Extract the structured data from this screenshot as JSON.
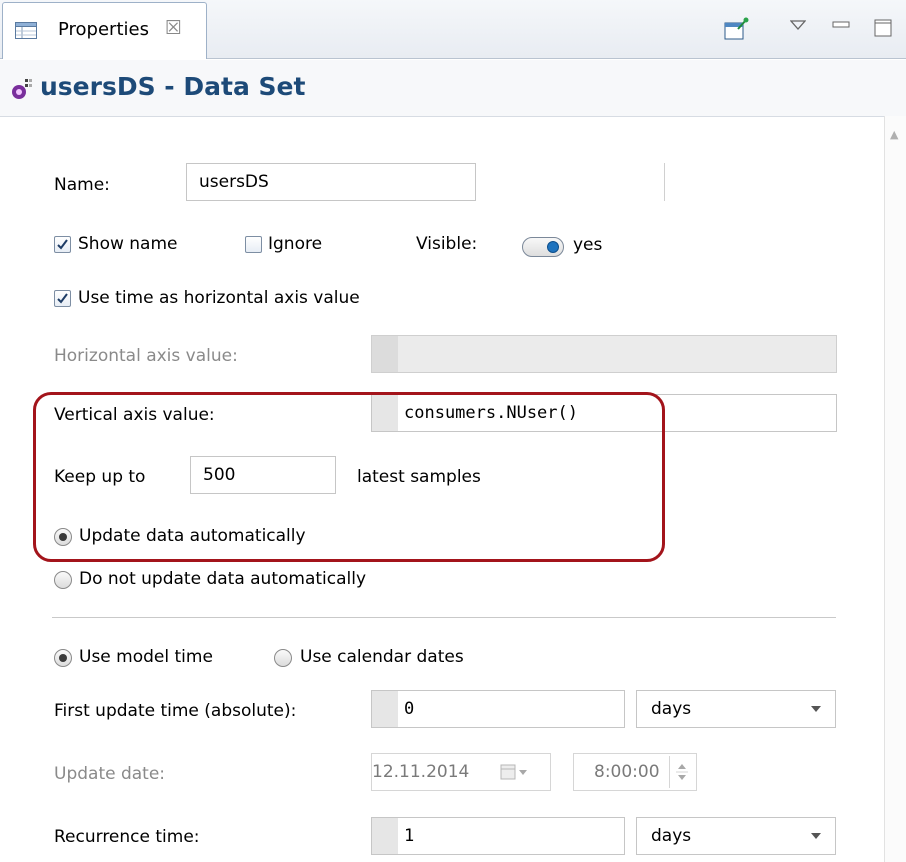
{
  "tab": {
    "label": "Properties",
    "close": "☒"
  },
  "header": {
    "title": "usersDS - Data Set"
  },
  "form": {
    "name_label": "Name:",
    "name_value": "usersDS",
    "show_name_label": "Show name",
    "ignore_label": "Ignore",
    "visible_label": "Visible:",
    "visible_value": "yes",
    "use_time_label": "Use time as horizontal axis value",
    "horizontal_label": "Horizontal axis value:",
    "vertical_label": "Vertical axis value:",
    "vertical_value": "consumers.NUser()",
    "keep_prefix": "Keep up to",
    "keep_value": "500",
    "keep_suffix": "latest samples",
    "update_auto_label": "Update data automatically",
    "no_update_label": "Do not update data automatically",
    "model_time_label": "Use model time",
    "calendar_label": "Use calendar dates",
    "first_update_label": "First update time (absolute):",
    "first_update_value": "0",
    "first_update_unit": "days",
    "update_date_label": "Update date:",
    "update_date_value": "12.11.2014",
    "update_time_value": "8:00:00",
    "recurrence_label": "Recurrence time:",
    "recurrence_value": "1",
    "recurrence_unit": "days"
  },
  "state": {
    "show_name_checked": true,
    "ignore_checked": false,
    "use_time_checked": true,
    "update_mode": "automatic",
    "time_mode": "model"
  },
  "colors": {
    "highlight": "#a3141b",
    "header_text": "#1d4a78",
    "toggle_knob": "#1e73be"
  }
}
